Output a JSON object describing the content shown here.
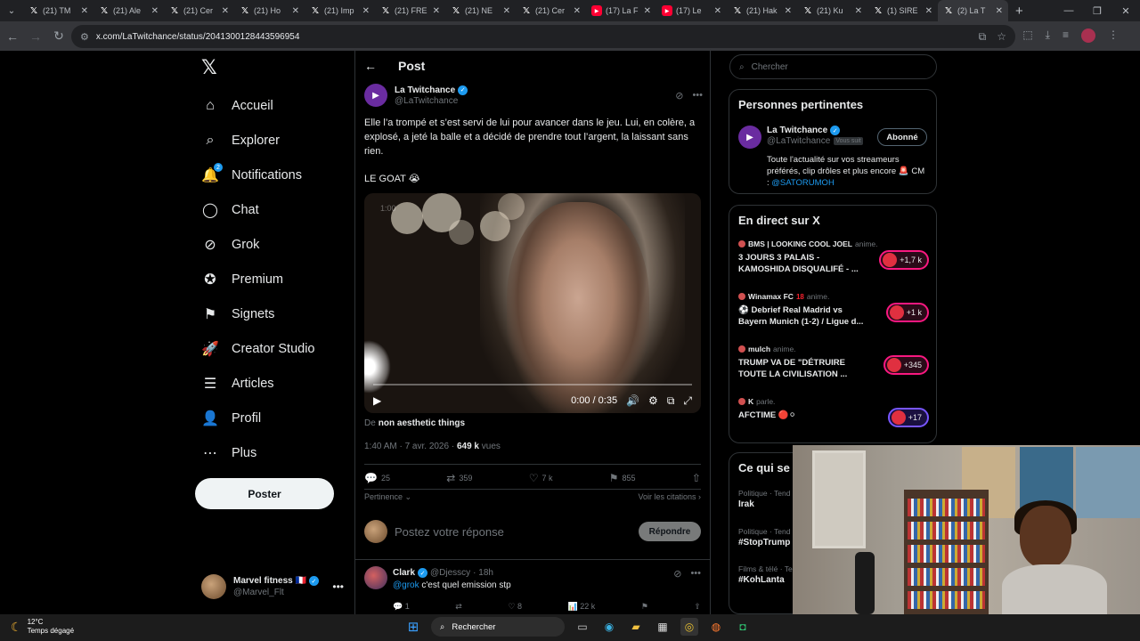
{
  "browser": {
    "tabs": [
      {
        "title": "(21) TM",
        "icon": "x-icon"
      },
      {
        "title": "(21) Ale",
        "icon": "x-icon"
      },
      {
        "title": "(21) Cer",
        "icon": "x-icon"
      },
      {
        "title": "(21) Ho",
        "icon": "x-icon"
      },
      {
        "title": "(21) Imp",
        "icon": "x-icon"
      },
      {
        "title": "(21) FRE",
        "icon": "x-icon"
      },
      {
        "title": "(21) NE",
        "icon": "x-icon"
      },
      {
        "title": "(21) Cer",
        "icon": "x-icon"
      },
      {
        "title": "(17) La F",
        "icon": "youtube-icon"
      },
      {
        "title": "(17) Le",
        "icon": "youtube-icon"
      },
      {
        "title": "(21) Hak",
        "icon": "x-icon"
      },
      {
        "title": "(21) Ku",
        "icon": "x-icon"
      },
      {
        "title": "(1) SIRE",
        "icon": "x-icon"
      },
      {
        "title": "(2) La T",
        "icon": "x-icon"
      }
    ],
    "url": "x.com/LaTwitchance/status/2041300128443596954"
  },
  "nav": {
    "items": [
      {
        "label": "Accueil",
        "icon": "home-icon"
      },
      {
        "label": "Explorer",
        "icon": "search-icon"
      },
      {
        "label": "Notifications",
        "icon": "bell-icon",
        "badge": "2"
      },
      {
        "label": "Chat",
        "icon": "chat-icon"
      },
      {
        "label": "Grok",
        "icon": "grok-icon"
      },
      {
        "label": "Premium",
        "icon": "premium-icon"
      },
      {
        "label": "Signets",
        "icon": "bookmark-icon"
      },
      {
        "label": "Creator Studio",
        "icon": "rocket-icon"
      },
      {
        "label": "Articles",
        "icon": "article-icon"
      },
      {
        "label": "Profil",
        "icon": "person-icon"
      },
      {
        "label": "Plus",
        "icon": "more-circle-icon"
      }
    ],
    "post_button": "Poster",
    "account": {
      "name": "Marvel fitness 🇫🇷",
      "handle": "@Marvel_Flt"
    }
  },
  "post": {
    "header_title": "Post",
    "author": {
      "name": "La Twitchance",
      "handle": "@LaTwitchance"
    },
    "text": "Elle l’a trompé et s’est servi de lui pour avancer dans le jeu. Lui, en colère, a explosé, a jeté la balle et a décidé de prendre tout l’argent, la laissant sans rien.",
    "text2": "LE GOAT 😭",
    "video": {
      "time": "0:00 / 0:35",
      "watermark": "1:00"
    },
    "from_prefix": "De",
    "from_name": "non aesthetic things",
    "time": "1:40 AM · 7 avr. 2026 ·",
    "views": "649 k",
    "views_label": "vues",
    "stats": {
      "replies": "25",
      "reposts": "359",
      "likes": "7 k",
      "bookmarks": "855"
    },
    "sort_label": "Pertinence",
    "quotes_label": "Voir les citations",
    "reply_placeholder": "Postez votre réponse",
    "reply_button": "Répondre"
  },
  "comment": {
    "name": "Clark",
    "handle": "@Djesscy",
    "age": "· 18h",
    "mention": "@grok",
    "text": "c'est quel emission stp",
    "stats": {
      "replies": "1",
      "likes": "8",
      "views": "22 k"
    }
  },
  "right": {
    "search_placeholder": "Chercher",
    "relevant": {
      "title": "Personnes pertinentes",
      "name": "La Twitchance",
      "handle": "@LaTwitchance",
      "follows_you": "Vous suit",
      "follow_button": "Abonné",
      "bio": "Toute l'actualité sur vos streameurs préférés, clip drôles et plus encore 🚨",
      "bio_cm": "CM :",
      "bio_mention": "@SATORUMOH"
    },
    "live": {
      "title": "En direct sur X",
      "items": [
        {
          "source": "BMS | LOOKING COOL JOEL",
          "action": "anime.",
          "title": "3 JOURS 3 PALAIS - KAMOSHIDA DISQUALIFÉ - ...",
          "count": "+1,7 k"
        },
        {
          "source": "Winamax FC",
          "extra": "18",
          "action": "anime.",
          "title": "⚽ Debrief Real Madrid vs Bayern Munich (1-2) / Ligue d...",
          "count": "+1 k"
        },
        {
          "source": "mulch",
          "action": "anime.",
          "title": "TRUMP VA DE \"DÉTRUIRE TOUTE LA CIVILISATION ...",
          "count": "+345"
        },
        {
          "source": "K",
          "action": "parle.",
          "title": "AFCTIME 🔴⚪",
          "count": "+17"
        }
      ]
    },
    "trends": {
      "title": "Ce qui se passe",
      "items": [
        {
          "category": "Politique · Tend",
          "title": "Irak"
        },
        {
          "category": "Politique · Tend",
          "title": "#StopTrump"
        },
        {
          "category": "Films & télé · Te",
          "title": "#KohLanta"
        }
      ]
    }
  },
  "taskbar": {
    "temp": "12°C",
    "weather": "Temps dégagé",
    "search": "Rechercher"
  }
}
